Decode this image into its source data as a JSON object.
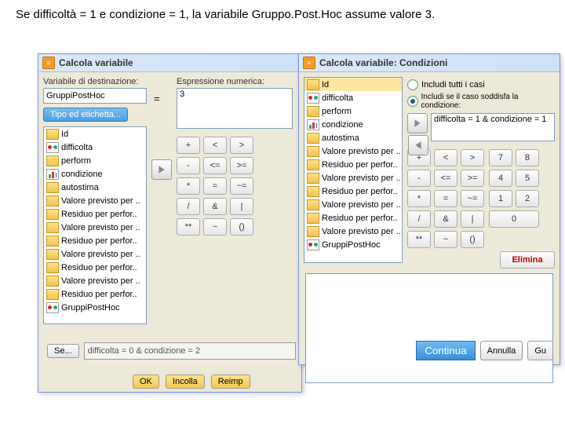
{
  "caption": "Se difficoltà = 1 e condizione = 1, la variabile Gruppo.Post.Hoc assume valore 3.",
  "dlg1": {
    "title": "Calcola variabile",
    "target_label": "Variabile di destinazione:",
    "target_value": "GruppiPostHoc",
    "type_btn": "Tipo ed etichetta...",
    "expr_label": "Espressione numerica:",
    "expr_value": "3",
    "equals": "=",
    "vars": [
      {
        "icon": "ruler",
        "label": "Id"
      },
      {
        "icon": "nom",
        "label": "difficolta"
      },
      {
        "icon": "ruler",
        "label": "perform"
      },
      {
        "icon": "ord",
        "label": "condizione"
      },
      {
        "icon": "ruler",
        "label": "autostima"
      },
      {
        "icon": "ruler",
        "label": "Valore previsto per .."
      },
      {
        "icon": "ruler",
        "label": "Residuo per perfor.."
      },
      {
        "icon": "ruler",
        "label": "Valore previsto per .."
      },
      {
        "icon": "ruler",
        "label": "Residuo per perfor.."
      },
      {
        "icon": "ruler",
        "label": "Valore previsto per .."
      },
      {
        "icon": "ruler",
        "label": "Residuo per perfor.."
      },
      {
        "icon": "ruler",
        "label": "Valore previsto per .."
      },
      {
        "icon": "ruler",
        "label": "Residuo per perfor.."
      },
      {
        "icon": "nom",
        "label": "GruppiPostHoc"
      }
    ],
    "keys_row1": [
      "+",
      "<",
      ">"
    ],
    "keys_row2": [
      "-",
      "<=",
      ">="
    ],
    "keys_row3": [
      "*",
      "=",
      "~="
    ],
    "keys_row4": [
      "/",
      "&",
      "|"
    ],
    "keys_row5": [
      "**",
      "~",
      "()"
    ],
    "se_btn": "Se...",
    "se_cond": "difficolta = 0 & condizione = 2",
    "ok": "OK",
    "paste": "Incolla",
    "reset": "Reimp"
  },
  "dlg2": {
    "title": "Calcola variabile: Condizioni",
    "vars": [
      {
        "icon": "ruler",
        "label": "Id",
        "sel": true
      },
      {
        "icon": "nom",
        "label": "difficolta"
      },
      {
        "icon": "ruler",
        "label": "perform"
      },
      {
        "icon": "ord",
        "label": "condizione"
      },
      {
        "icon": "ruler",
        "label": "autostima"
      },
      {
        "icon": "ruler",
        "label": "Valore previsto per .."
      },
      {
        "icon": "ruler",
        "label": "Residuo per perfor.."
      },
      {
        "icon": "ruler",
        "label": "Valore previsto per .."
      },
      {
        "icon": "ruler",
        "label": "Residuo per perfor.."
      },
      {
        "icon": "ruler",
        "label": "Valore previsto per .."
      },
      {
        "icon": "ruler",
        "label": "Residuo per perfor.."
      },
      {
        "icon": "ruler",
        "label": "Valore previsto per .."
      },
      {
        "icon": "nom",
        "label": "GruppiPostHoc"
      }
    ],
    "opt_all": "Includi tutti i casi",
    "opt_if": "Includi se il caso soddisfa la condizione:",
    "cond": "difficolta = 1 & condizione = 1",
    "keys_row1": [
      "+",
      "<",
      ">"
    ],
    "keys_row2": [
      "-",
      "<=",
      ">="
    ],
    "keys_row3": [
      "*",
      "=",
      "~="
    ],
    "keys_row4": [
      "/",
      "&",
      "|"
    ],
    "keys_row5": [
      "**",
      "~",
      "()"
    ],
    "num_row1": [
      "7",
      "8"
    ],
    "num_row2": [
      "4",
      "5"
    ],
    "num_row3": [
      "1",
      "2"
    ],
    "num_row4": [
      "0"
    ],
    "del": "Elimina",
    "cont": "Continua",
    "cancel": "Annulla",
    "help": "Gu"
  }
}
